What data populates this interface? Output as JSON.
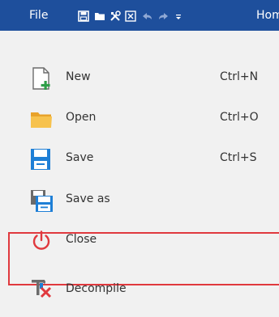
{
  "toolbar": {
    "file_label": "File",
    "home_label": "Hom",
    "quick_icons": [
      "save-icon",
      "open-folder-icon",
      "tools-icon",
      "export-icon",
      "undo-icon",
      "redo-icon",
      "dropdown-icon"
    ]
  },
  "menu": {
    "items": [
      {
        "label": "New",
        "shortcut": "Ctrl+N",
        "icon": "new-file-icon"
      },
      {
        "label": "Open",
        "shortcut": "Ctrl+O",
        "icon": "folder-icon"
      },
      {
        "label": "Save",
        "shortcut": "Ctrl+S",
        "icon": "save-icon"
      },
      {
        "label": "Save as",
        "shortcut": "",
        "icon": "save-as-icon"
      },
      {
        "label": "Close",
        "shortcut": "",
        "icon": "power-icon"
      },
      {
        "label": "Decompile",
        "shortcut": "",
        "icon": "decompile-icon"
      }
    ]
  },
  "colors": {
    "toolbar_bg": "#1e4f9c",
    "menu_bg": "#f1f1f1",
    "highlight_border": "#e0393e",
    "accent_blue": "#1e7fd6",
    "folder_orange": "#f5b93c",
    "power_red": "#e0393e",
    "new_green": "#2e9e48"
  }
}
